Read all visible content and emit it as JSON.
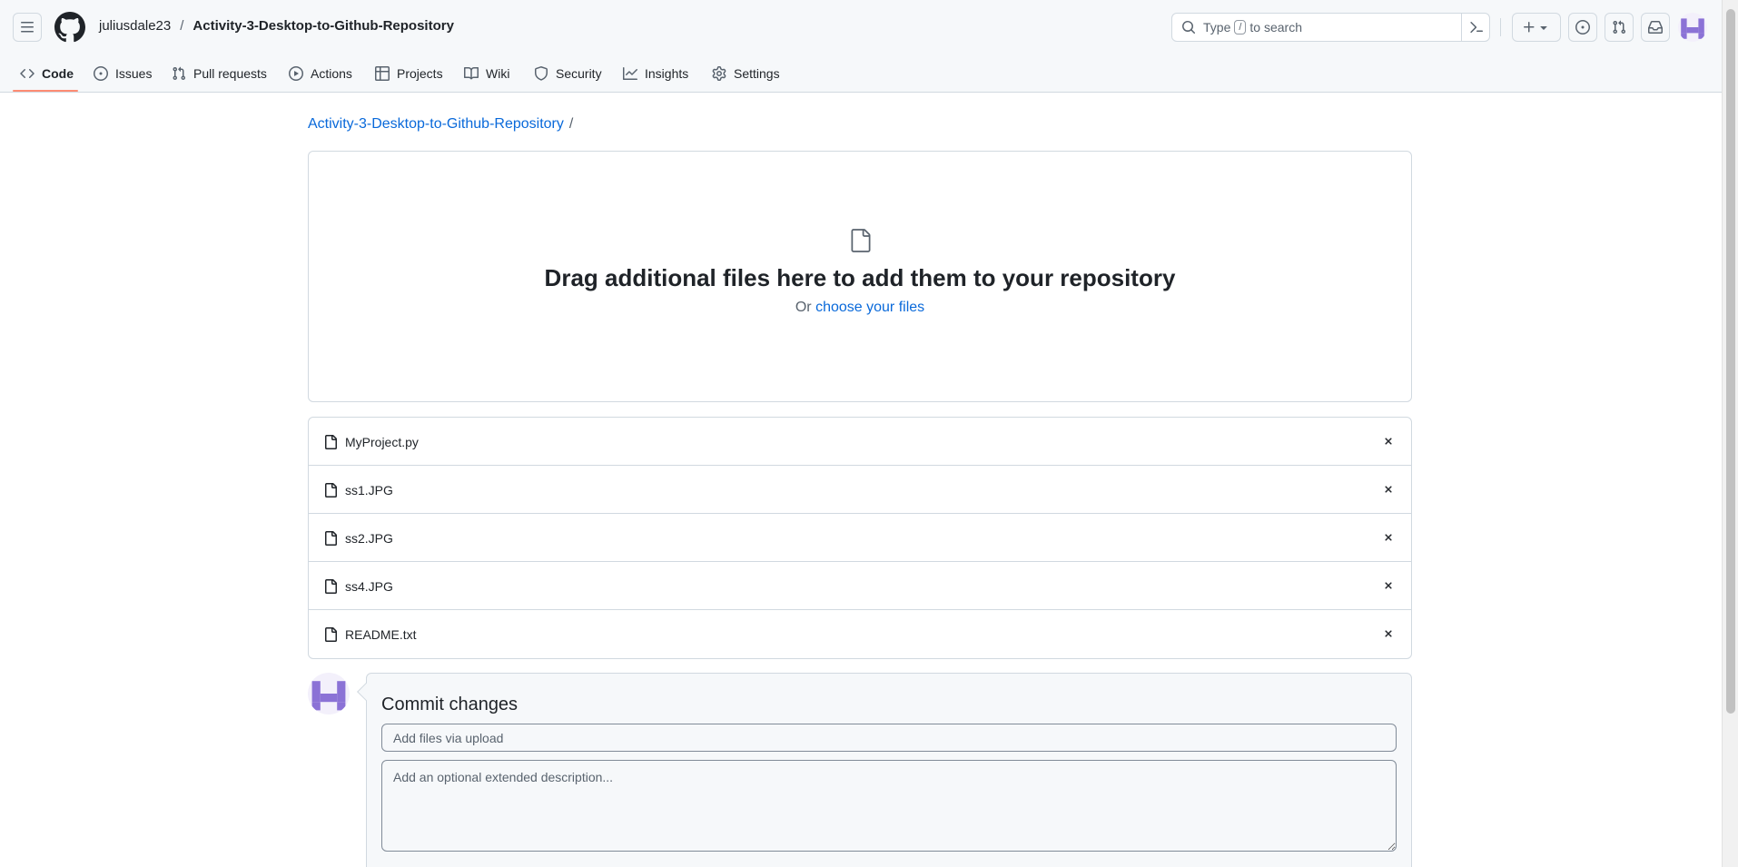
{
  "header": {
    "owner": "juliusdale23",
    "separator": "/",
    "repo": "Activity-3-Desktop-to-Github-Repository",
    "search": {
      "prefix": "Type",
      "kbd": "/",
      "suffix": "to search"
    },
    "icons": [
      "hamburger-icon",
      "github-logo-icon",
      "search-icon",
      "command-palette-icon",
      "plus-icon",
      "issues-icon",
      "pull-requests-icon",
      "inbox-icon",
      "avatar"
    ]
  },
  "tabs": [
    {
      "label": "Code",
      "icon": "code-icon",
      "active": true
    },
    {
      "label": "Issues",
      "icon": "issue-opened-icon"
    },
    {
      "label": "Pull requests",
      "icon": "git-pull-request-icon"
    },
    {
      "label": "Actions",
      "icon": "play-icon"
    },
    {
      "label": "Projects",
      "icon": "table-icon"
    },
    {
      "label": "Wiki",
      "icon": "book-icon"
    },
    {
      "label": "Security",
      "icon": "shield-icon"
    },
    {
      "label": "Insights",
      "icon": "graph-icon"
    },
    {
      "label": "Settings",
      "icon": "gear-icon"
    }
  ],
  "main": {
    "breadcrumb": {
      "repo_link": "Activity-3-Desktop-to-Github-Repository",
      "slash": "/"
    },
    "dropzone": {
      "title": "Drag additional files here to add them to your repository",
      "sub_prefix": "Or",
      "sub_link": "choose your files"
    },
    "files": [
      {
        "name": "MyProject.py"
      },
      {
        "name": "ss1.JPG"
      },
      {
        "name": "ss2.JPG"
      },
      {
        "name": "ss4.JPG"
      },
      {
        "name": "README.txt"
      }
    ],
    "commit": {
      "title": "Commit changes",
      "summary_placeholder": "Add files via upload",
      "description_placeholder": "Add an optional extended description..."
    }
  },
  "colors": {
    "link": "#0969da",
    "tab_underline": "#fd8c73",
    "avatar_purple": "#8b72d6",
    "border": "#d1d9e0"
  }
}
